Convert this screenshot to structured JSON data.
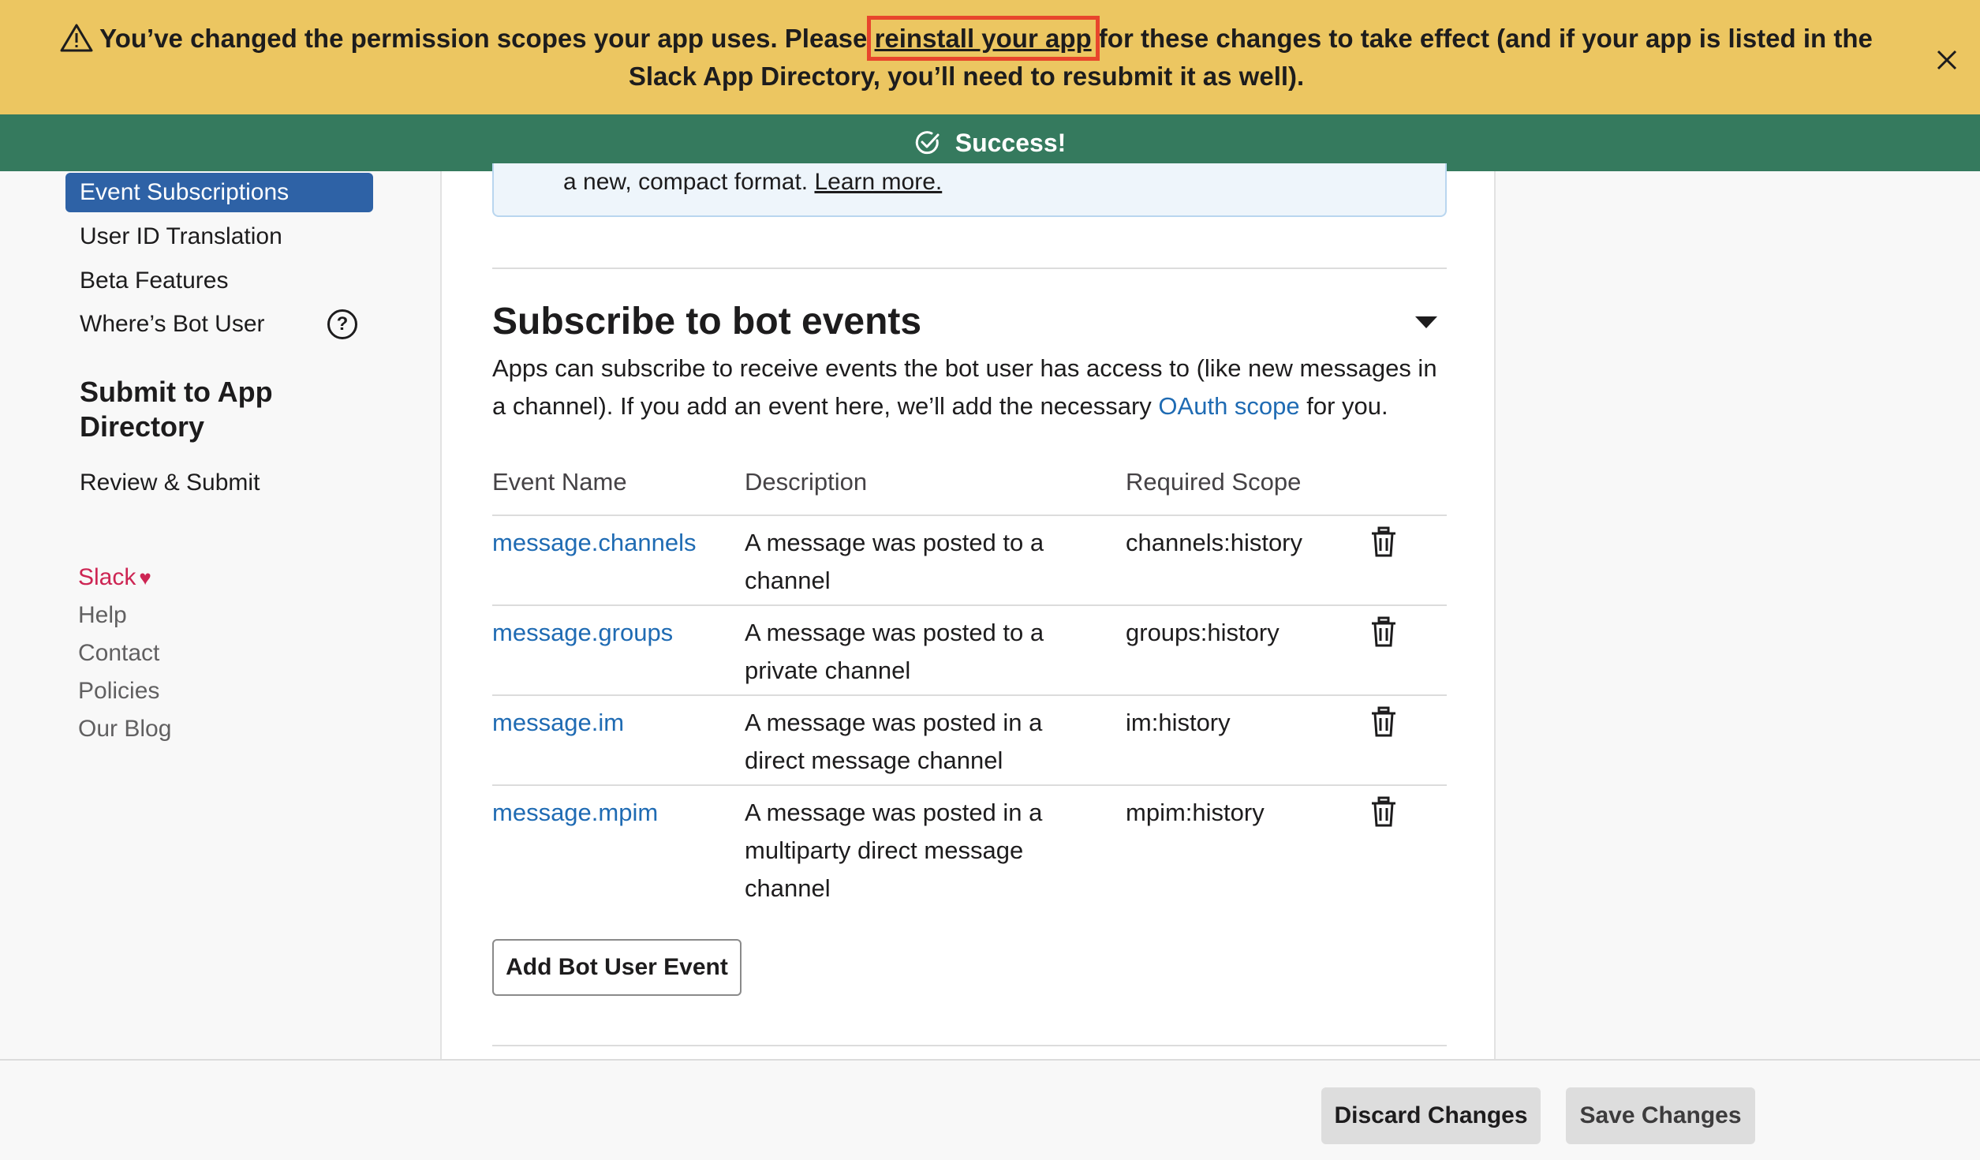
{
  "banner": {
    "text_before": "You’ve changed the permission scopes your app uses. Please ",
    "link_text": "reinstall your app",
    "text_after": " for these changes to take effect (and if your app is listed in the Slack App Directory, you’ll need to resubmit it as well).",
    "icon": "warning-icon",
    "close_icon": "close-icon",
    "color": "#ecc661"
  },
  "success": {
    "text": "Success!",
    "icon": "check-circle-icon",
    "color": "#357a5e"
  },
  "sidebar": {
    "items": [
      {
        "label": "Event Subscriptions",
        "active": true
      },
      {
        "label": "User ID Translation"
      },
      {
        "label": "Beta Features"
      },
      {
        "label": "Where’s Bot User",
        "help_icon": "?"
      }
    ],
    "section_heading": "Submit to App Directory",
    "review_item": "Review & Submit",
    "footer": {
      "slack": "Slack",
      "heart": "♥",
      "links": [
        "Help",
        "Contact",
        "Policies",
        "Our Blog"
      ]
    }
  },
  "main": {
    "info_text": "a new, compact format. ",
    "info_link": "Learn more.",
    "section_title": "Subscribe to bot events",
    "desc_before": "Apps can subscribe to receive events the bot user has access to (like new messages in a channel). If you add an event here, we’ll add the necessary ",
    "desc_link": "OAuth scope",
    "desc_after": " for you.",
    "columns": [
      "Event Name",
      "Description",
      "Required Scope"
    ],
    "rows": [
      {
        "name": "message.channels",
        "description": "A message was posted to a channel",
        "scope": "channels:history"
      },
      {
        "name": "message.groups",
        "description": "A message was posted to a private channel",
        "scope": "groups:history"
      },
      {
        "name": "message.im",
        "description": "A message was posted in a direct message channel",
        "scope": "im:history"
      },
      {
        "name": "message.mpim",
        "description": "A message was posted in a multiparty direct message channel",
        "scope": "mpim:history"
      }
    ],
    "add_button": "Add Bot User Event",
    "link_color": "#1f6bb3"
  },
  "footer_bar": {
    "discard": "Discard Changes",
    "save": "Save Changes"
  }
}
